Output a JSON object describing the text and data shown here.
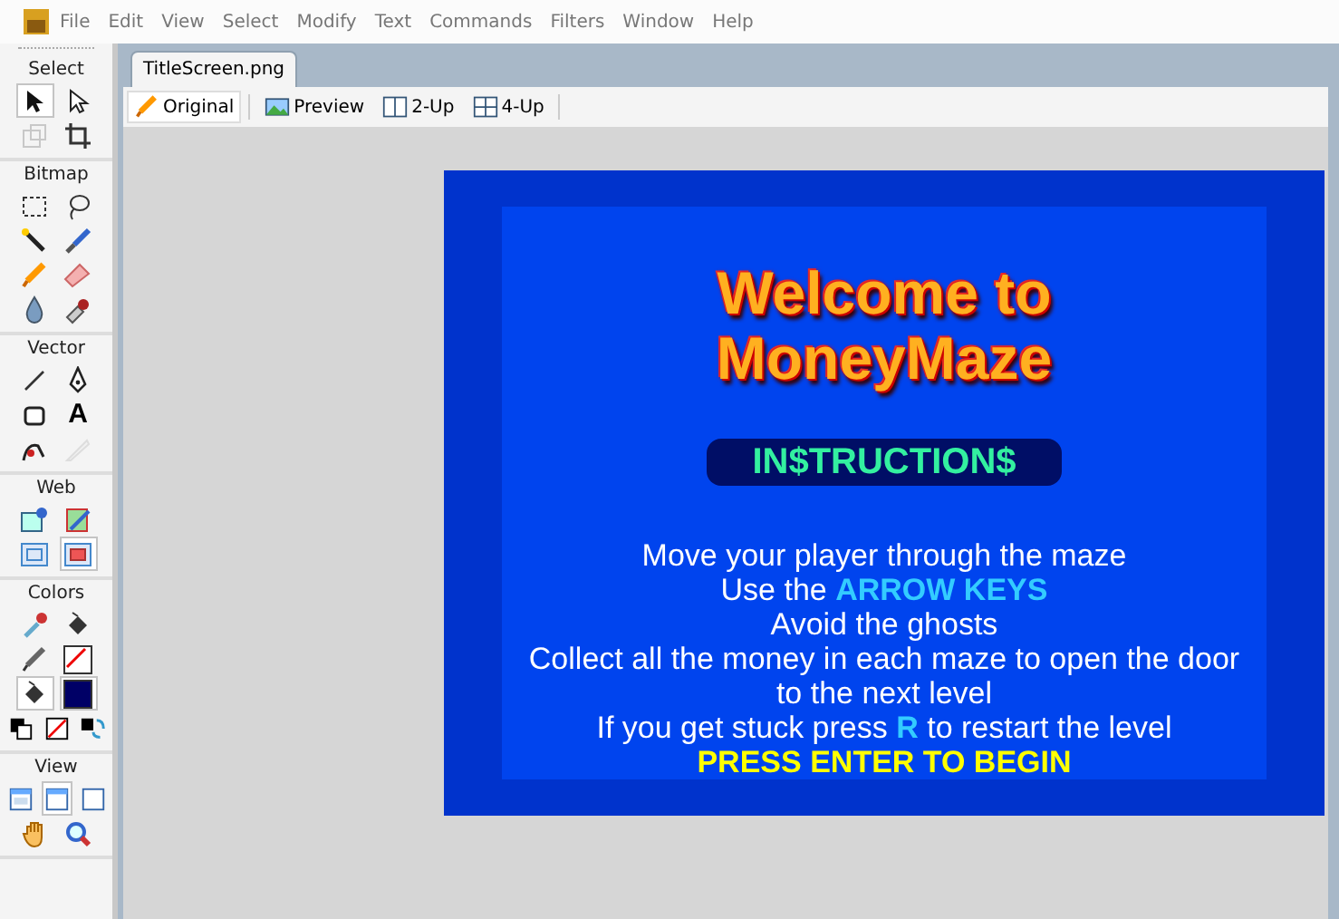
{
  "menu": [
    "File",
    "Edit",
    "View",
    "Select",
    "Modify",
    "Text",
    "Commands",
    "Filters",
    "Window",
    "Help"
  ],
  "tools_panel": [
    {
      "title": "Select",
      "rows": [
        [
          {
            "kind": "pointer",
            "selected": true,
            "disabled": false
          },
          {
            "kind": "subselect",
            "selected": false,
            "disabled": false
          }
        ],
        [
          {
            "kind": "scale",
            "selected": false,
            "disabled": true
          },
          {
            "kind": "crop",
            "selected": false,
            "disabled": false
          }
        ]
      ]
    },
    {
      "title": "Bitmap",
      "rows": [
        [
          {
            "kind": "marquee",
            "selected": false,
            "disabled": false
          },
          {
            "kind": "lasso",
            "selected": false,
            "disabled": false
          }
        ],
        [
          {
            "kind": "wand",
            "selected": false,
            "disabled": false
          },
          {
            "kind": "brush",
            "selected": false,
            "disabled": false
          }
        ],
        [
          {
            "kind": "pencil",
            "selected": false,
            "disabled": false
          },
          {
            "kind": "eraser",
            "selected": false,
            "disabled": false
          }
        ],
        [
          {
            "kind": "drop",
            "selected": false,
            "disabled": false
          },
          {
            "kind": "stamp",
            "selected": false,
            "disabled": false
          }
        ]
      ]
    },
    {
      "title": "Vector",
      "rows": [
        [
          {
            "kind": "line",
            "selected": false,
            "disabled": false
          },
          {
            "kind": "pen",
            "selected": false,
            "disabled": false
          }
        ],
        [
          {
            "kind": "rect",
            "selected": false,
            "disabled": false
          },
          {
            "kind": "text",
            "glyph": "A",
            "selected": false,
            "disabled": false
          }
        ],
        [
          {
            "kind": "freeform",
            "selected": false,
            "disabled": false
          },
          {
            "kind": "knife",
            "selected": false,
            "disabled": true
          }
        ]
      ]
    },
    {
      "title": "Web",
      "rows": [
        [
          {
            "kind": "hotspot",
            "selected": false,
            "disabled": false
          },
          {
            "kind": "slice",
            "selected": false,
            "disabled": false
          }
        ],
        [
          {
            "kind": "hide",
            "selected": false,
            "disabled": false
          },
          {
            "kind": "show",
            "selected": true,
            "disabled": false
          }
        ]
      ]
    },
    {
      "title": "Colors",
      "rows": [
        [
          {
            "kind": "eyedropper",
            "selected": false,
            "disabled": false
          },
          {
            "kind": "bucket",
            "selected": false,
            "disabled": false
          }
        ],
        [
          {
            "kind": "strokepencil",
            "selected": false,
            "disabled": false
          },
          {
            "kind": "swatch",
            "color": "#ffffff",
            "slash": true,
            "selected": false,
            "disabled": false
          }
        ],
        [
          {
            "kind": "bucket",
            "selected": true,
            "disabled": false
          },
          {
            "kind": "swatch",
            "color": "#000066",
            "slash": false,
            "selected": true,
            "disabled": false
          }
        ],
        [
          {
            "kind": "defaults",
            "selected": false,
            "disabled": false
          },
          {
            "kind": "nocolor",
            "selected": false,
            "disabled": false
          },
          {
            "kind": "swap",
            "selected": false,
            "disabled": false
          }
        ]
      ]
    },
    {
      "title": "View",
      "rows": [
        [
          {
            "kind": "screen1",
            "selected": false,
            "disabled": false
          },
          {
            "kind": "screen2",
            "selected": true,
            "disabled": false
          },
          {
            "kind": "screen3",
            "selected": false,
            "disabled": false
          }
        ],
        [
          {
            "kind": "hand",
            "selected": false,
            "disabled": false
          },
          {
            "kind": "zoom",
            "selected": false,
            "disabled": false
          }
        ]
      ]
    }
  ],
  "document_tab": {
    "label": "TitleScreen.png",
    "selected": true
  },
  "view_modes": [
    {
      "label": "Original",
      "kind": "pencil",
      "selected": true
    },
    {
      "label": "Preview",
      "kind": "preview",
      "selected": false
    },
    {
      "label": "2-Up",
      "kind": "two",
      "selected": false
    },
    {
      "label": "4-Up",
      "kind": "four",
      "selected": false
    }
  ],
  "canvas": {
    "title_lines": [
      "Welcome to",
      "MoneyMaze"
    ],
    "button": "IN$TRUCTION$",
    "lines": [
      {
        "kind": "text",
        "parts": [
          {
            "text": "Move your player through the maze",
            "accent": false
          }
        ]
      },
      {
        "kind": "text",
        "parts": [
          {
            "text": "Use the ",
            "accent": false
          },
          {
            "text": "ARROW KEYS",
            "accent": true
          }
        ]
      },
      {
        "kind": "text",
        "parts": [
          {
            "text": "Avoid the ghosts",
            "accent": false
          }
        ]
      },
      {
        "kind": "text",
        "parts": [
          {
            "text": "Collect all the money in each maze to open the door to the next level",
            "accent": false
          }
        ]
      },
      {
        "kind": "text",
        "parts": [
          {
            "text": "If you get stuck press ",
            "accent": false
          },
          {
            "text": "R",
            "accent": true
          },
          {
            "text": " to restart the level",
            "accent": false
          }
        ]
      },
      {
        "kind": "prompt",
        "parts": [
          {
            "text": "PRESS ENTER TO BEGIN",
            "accent": false
          }
        ]
      }
    ]
  }
}
